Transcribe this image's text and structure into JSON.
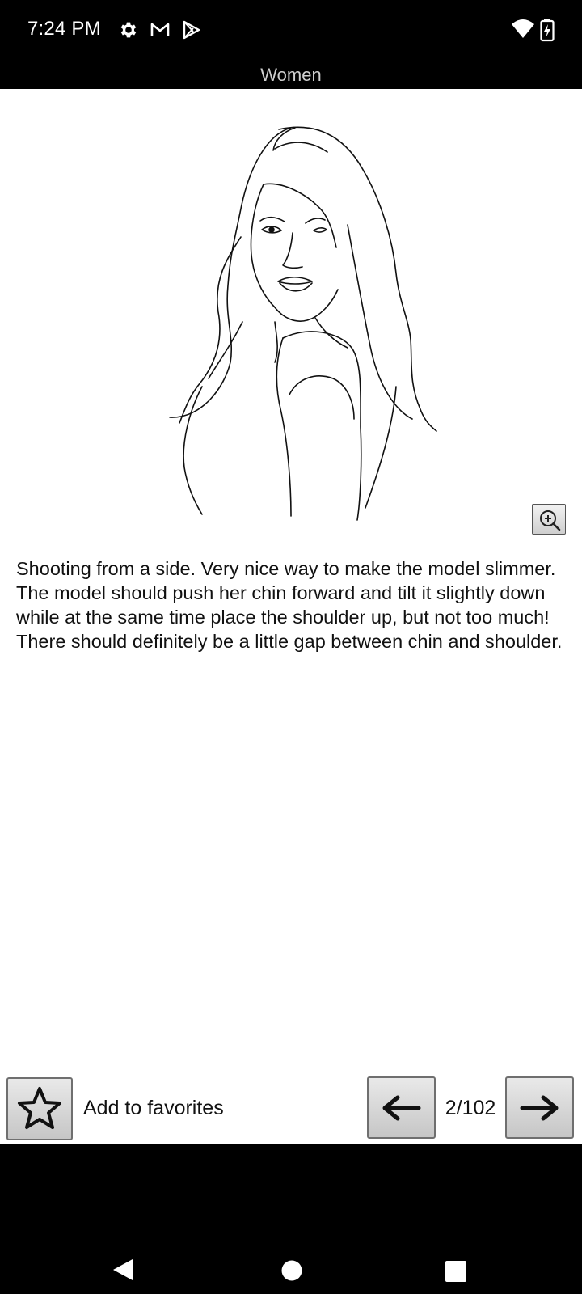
{
  "status_bar": {
    "time": "7:24 PM",
    "left_icons": [
      "settings-icon",
      "gmail-icon",
      "play-store-icon"
    ],
    "right_icons": [
      "wifi-icon",
      "battery-charging-icon"
    ]
  },
  "header": {
    "title": "Women"
  },
  "main": {
    "illustration": "woman-pose-sketch",
    "zoom_icon": "zoom-in-icon",
    "description": "Shooting from a side. Very nice way to make the model slimmer. The model should push her chin forward and tilt it slightly down while at the same time place the shoulder up, but not too much! There should definitely be a little gap between chin and shoulder."
  },
  "bottom_bar": {
    "favorite_icon": "star-icon",
    "favorite_label": "Add to favorites",
    "prev_icon": "arrow-left-icon",
    "page_counter": "2/102",
    "next_icon": "arrow-right-icon"
  },
  "nav_bar": {
    "icons": [
      "back-icon",
      "home-icon",
      "recents-icon"
    ]
  },
  "colors": {
    "system_bars": "#000000",
    "content_bg": "#ffffff",
    "title_text": "#cfcfcf",
    "button_gradient_top": "#e9e9e9",
    "button_gradient_bottom": "#c6c6c6"
  }
}
